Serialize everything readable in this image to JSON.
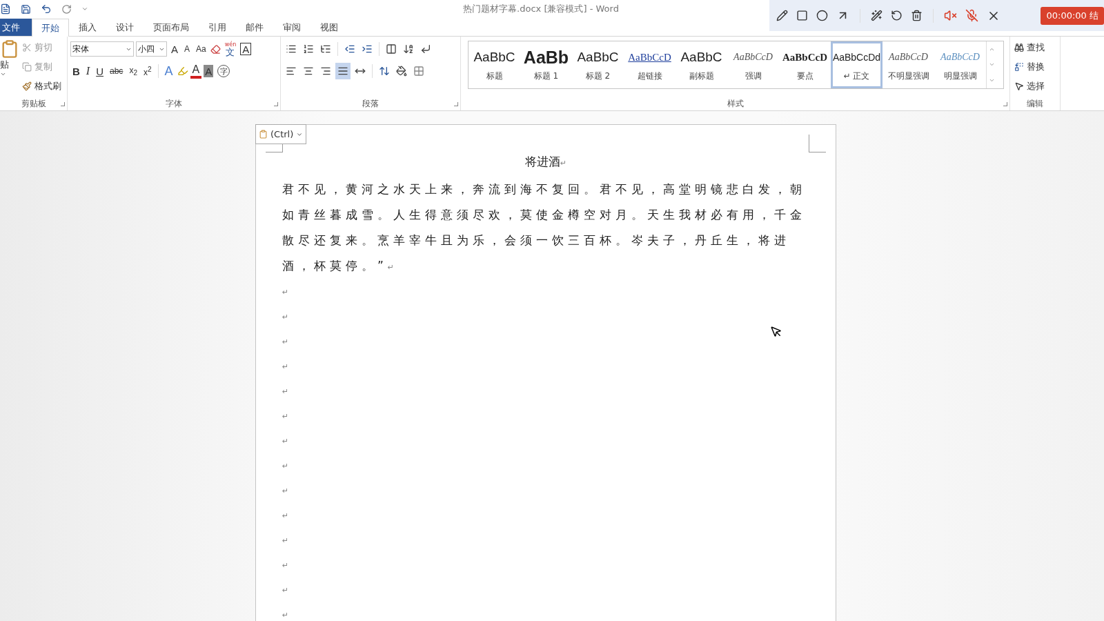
{
  "window": {
    "title": "热门题材字幕.docx [兼容模式] - Word"
  },
  "tabs": [
    {
      "label": "文件",
      "kind": "file",
      "selected": false
    },
    {
      "label": "开始",
      "kind": "tab",
      "selected": true
    },
    {
      "label": "插入",
      "kind": "tab",
      "selected": false
    },
    {
      "label": "设计",
      "kind": "tab",
      "selected": false
    },
    {
      "label": "页面布局",
      "kind": "tab",
      "selected": false
    },
    {
      "label": "引用",
      "kind": "tab",
      "selected": false
    },
    {
      "label": "邮件",
      "kind": "tab",
      "selected": false
    },
    {
      "label": "审阅",
      "kind": "tab",
      "selected": false
    },
    {
      "label": "视图",
      "kind": "tab",
      "selected": false
    }
  ],
  "clipboard": {
    "label": "剪贴板",
    "paste": "贴",
    "items": [
      {
        "label": "剪切",
        "disabled": true
      },
      {
        "label": "复制",
        "disabled": true
      },
      {
        "label": "格式刷",
        "disabled": false
      }
    ]
  },
  "font": {
    "label": "字体",
    "name": "宋体",
    "size": "小四",
    "grow": "A",
    "shrink": "A",
    "case": "Aa",
    "phonetic_guide": "wén",
    "phonetic": "文",
    "border": "A",
    "bold": "B",
    "italic": "I",
    "underline": "U",
    "strike": "abc",
    "subscript": "x$_{2}$",
    "superscript": "x$^{2}$",
    "effects": "A",
    "font_color": "A",
    "shading": "A",
    "enclose": "字"
  },
  "paragraph": {
    "label": "段落",
    "alignment": [
      {
        "selected": false
      },
      {
        "selected": false
      },
      {
        "selected": false
      },
      {
        "selected": true
      },
      {
        "selected": false
      }
    ]
  },
  "styles": {
    "label": "样式",
    "items": [
      {
        "preview": "AaBbC",
        "name": "标题",
        "kind": "title",
        "selected": false
      },
      {
        "preview": "AaBb",
        "name": "标题 1",
        "kind": "heading1",
        "selected": false
      },
      {
        "preview": "AaBbC",
        "name": "标题 2",
        "kind": "heading2",
        "selected": false
      },
      {
        "preview": "AaBbCcD",
        "name": "超链接",
        "kind": "link",
        "selected": false
      },
      {
        "preview": "AaBbC",
        "name": "副标题",
        "kind": "subtitle",
        "selected": false
      },
      {
        "preview": "AaBbCcD",
        "name": "强调",
        "kind": "emphasis",
        "selected": false
      },
      {
        "preview": "AaBbCcD",
        "name": "要点",
        "kind": "strong",
        "selected": false
      },
      {
        "preview": "AaBbCcDd",
        "name": "↵ 正文",
        "kind": "normal",
        "selected": true
      },
      {
        "preview": "AaBbCcD",
        "name": "不明显强调",
        "kind": "subtle",
        "selected": false
      },
      {
        "preview": "AaBbCcD",
        "name": "明显强调",
        "kind": "intense",
        "selected": false
      }
    ]
  },
  "editing": {
    "label": "编辑",
    "find": "查找",
    "replace": "替换",
    "select": "选择"
  },
  "recorder": {
    "timer": "00:00:00 结"
  },
  "paste_options": {
    "label": "(Ctrl)"
  },
  "document": {
    "title": "将进酒",
    "paragraph": "君不见，黄河之水天上来，奔流到海不复回。君不见，高堂明镜悲白发，朝如青丝暮成雪。人生得意须尽欢，莫使金樽空对月。天生我材必有用，千金散尽还复来。烹羊宰牛且为乐，会须一饮三百杯。岑夫子，丹丘生，将进酒，杯莫停。”",
    "mark": "↵",
    "empty_paragraphs": [
      "↵",
      "↵",
      "↵",
      "↵",
      "↵",
      "↵",
      "↵",
      "↵",
      "↵",
      "↵",
      "↵",
      "↵",
      "↵",
      "↵"
    ]
  }
}
